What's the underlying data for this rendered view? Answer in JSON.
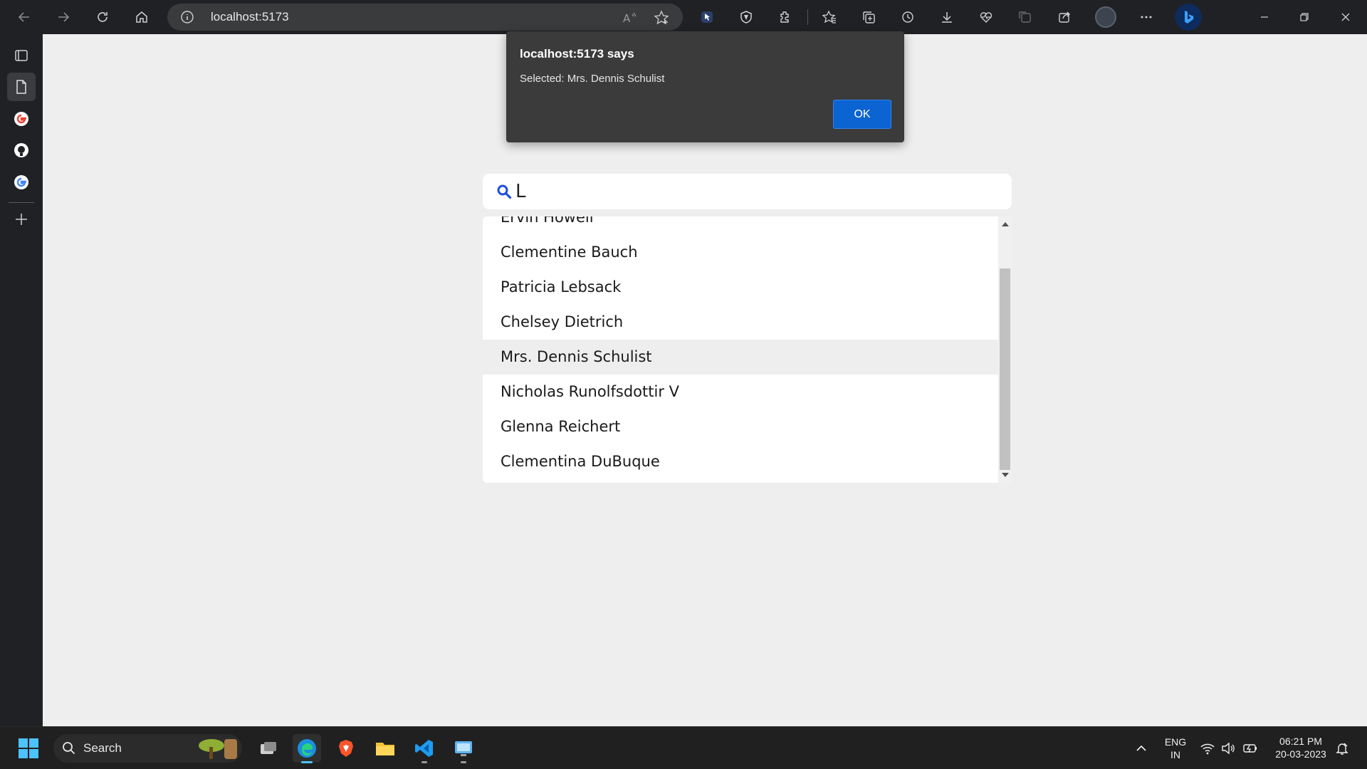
{
  "browser": {
    "url": "localhost:5173"
  },
  "search": {
    "value": "L"
  },
  "results": {
    "items": [
      "Ervin Howell",
      "Clementine Bauch",
      "Patricia Lebsack",
      "Chelsey Dietrich",
      "Mrs. Dennis Schulist",
      "Nicholas Runolfsdottir V",
      "Glenna Reichert",
      "Clementina DuBuque"
    ],
    "highlighted_index": 4
  },
  "alert": {
    "title": "localhost:5173 says",
    "message": "Selected: Mrs. Dennis Schulist",
    "ok_label": "OK"
  },
  "taskbar": {
    "search_label": "Search",
    "lang_line1": "ENG",
    "lang_line2": "IN",
    "time": "06:21 PM",
    "date": "20-03-2023"
  },
  "colors": {
    "accent": "#0b64d2",
    "browser_chrome": "#202124",
    "page_bg": "#eeeeee",
    "highlight_row": "#eeeeee"
  },
  "icons": {
    "toolbar": [
      "back-icon",
      "forward-icon",
      "refresh-icon",
      "home-icon",
      "info-icon",
      "read-aloud-icon",
      "add-favorite-icon",
      "cursor-extension-icon",
      "shield-extension-icon",
      "extensions-icon",
      "favorites-icon",
      "collections-icon",
      "history-icon",
      "downloads-icon",
      "performance-icon",
      "screenshot-icon",
      "share-icon",
      "profile-icon",
      "more-icon",
      "bing-icon"
    ],
    "sidebar": [
      "tab-actions-icon",
      "page-icon",
      "google-icon",
      "github-icon",
      "google-icon",
      "add-icon"
    ]
  }
}
